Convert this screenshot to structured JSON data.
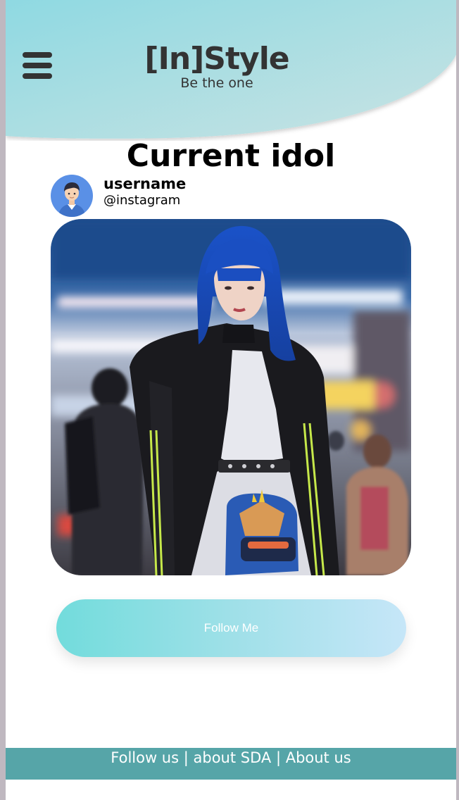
{
  "header": {
    "brand_title": "[In]Style",
    "brand_tagline": "Be the one",
    "menu_icon": "hamburger-menu-icon",
    "gradient_start": "#8fd9e2",
    "gradient_end": "#c9e3e3"
  },
  "idol": {
    "section_title": "Current idol",
    "username": "username",
    "handle": "@instagram",
    "avatar_icon": "user-avatar-icon",
    "photo_alt": "street-style-photo"
  },
  "actions": {
    "follow_label": "Follow Me"
  },
  "footer": {
    "link_follow": "Follow us",
    "link_about_sda": "about SDA",
    "link_about_us": "About us",
    "separator": " | ",
    "background": "#56a5a8"
  }
}
